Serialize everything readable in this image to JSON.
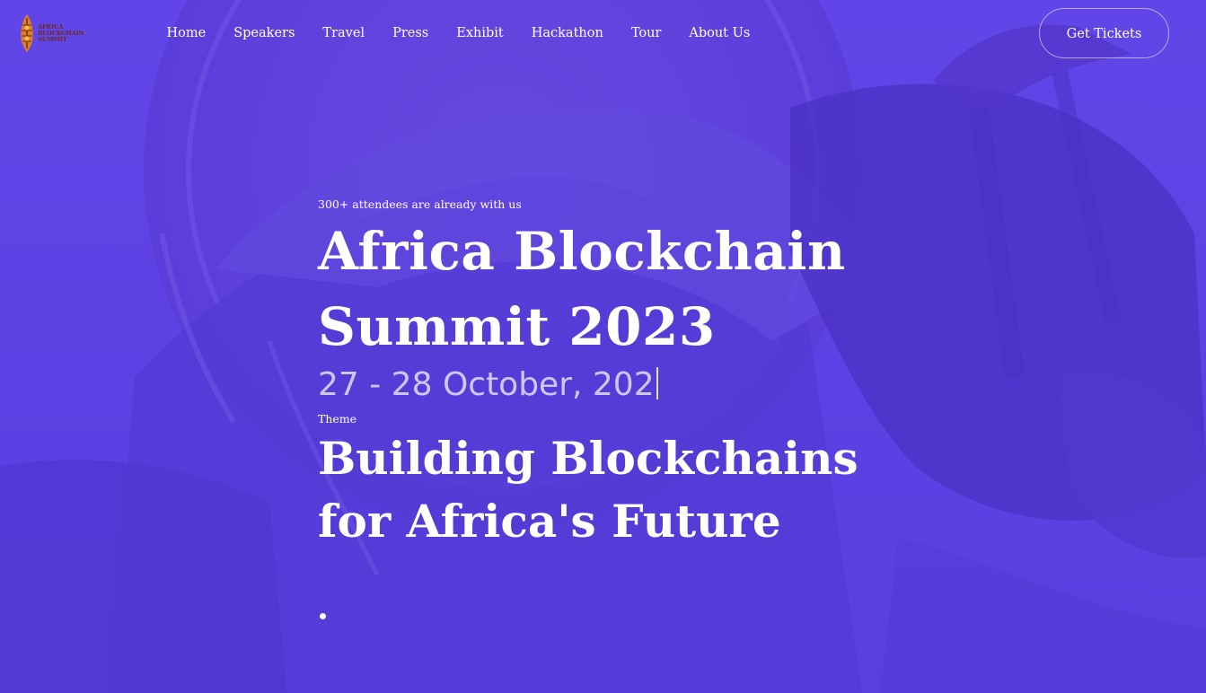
{
  "header": {
    "logo": {
      "line1": "AFRICA",
      "line2": "BLOCKCHAIN",
      "line3": "SUMMIT"
    },
    "nav": [
      {
        "label": "Home"
      },
      {
        "label": "Speakers"
      },
      {
        "label": "Travel"
      },
      {
        "label": "Press"
      },
      {
        "label": "Exhibit"
      },
      {
        "label": "Hackathon"
      },
      {
        "label": "Tour"
      },
      {
        "label": "About Us"
      }
    ],
    "cta_label": "Get Tickets"
  },
  "hero": {
    "attendees": "300+ attendees are already with us",
    "title_line1": "Africa Blockchain",
    "title_line2": "Summit 2023",
    "date_typing": "27 - 28 October, 202",
    "theme_label": "Theme",
    "theme_line1": "Building Blockchains",
    "theme_line2": "for Africa's Future"
  },
  "colors": {
    "overlay": "#5a38e8",
    "text": "#ffffff",
    "date_text": "#cfc6f7"
  },
  "icons": {
    "logo": "africa-shield-logo-icon",
    "carousel": "carousel-dot-indicator"
  }
}
